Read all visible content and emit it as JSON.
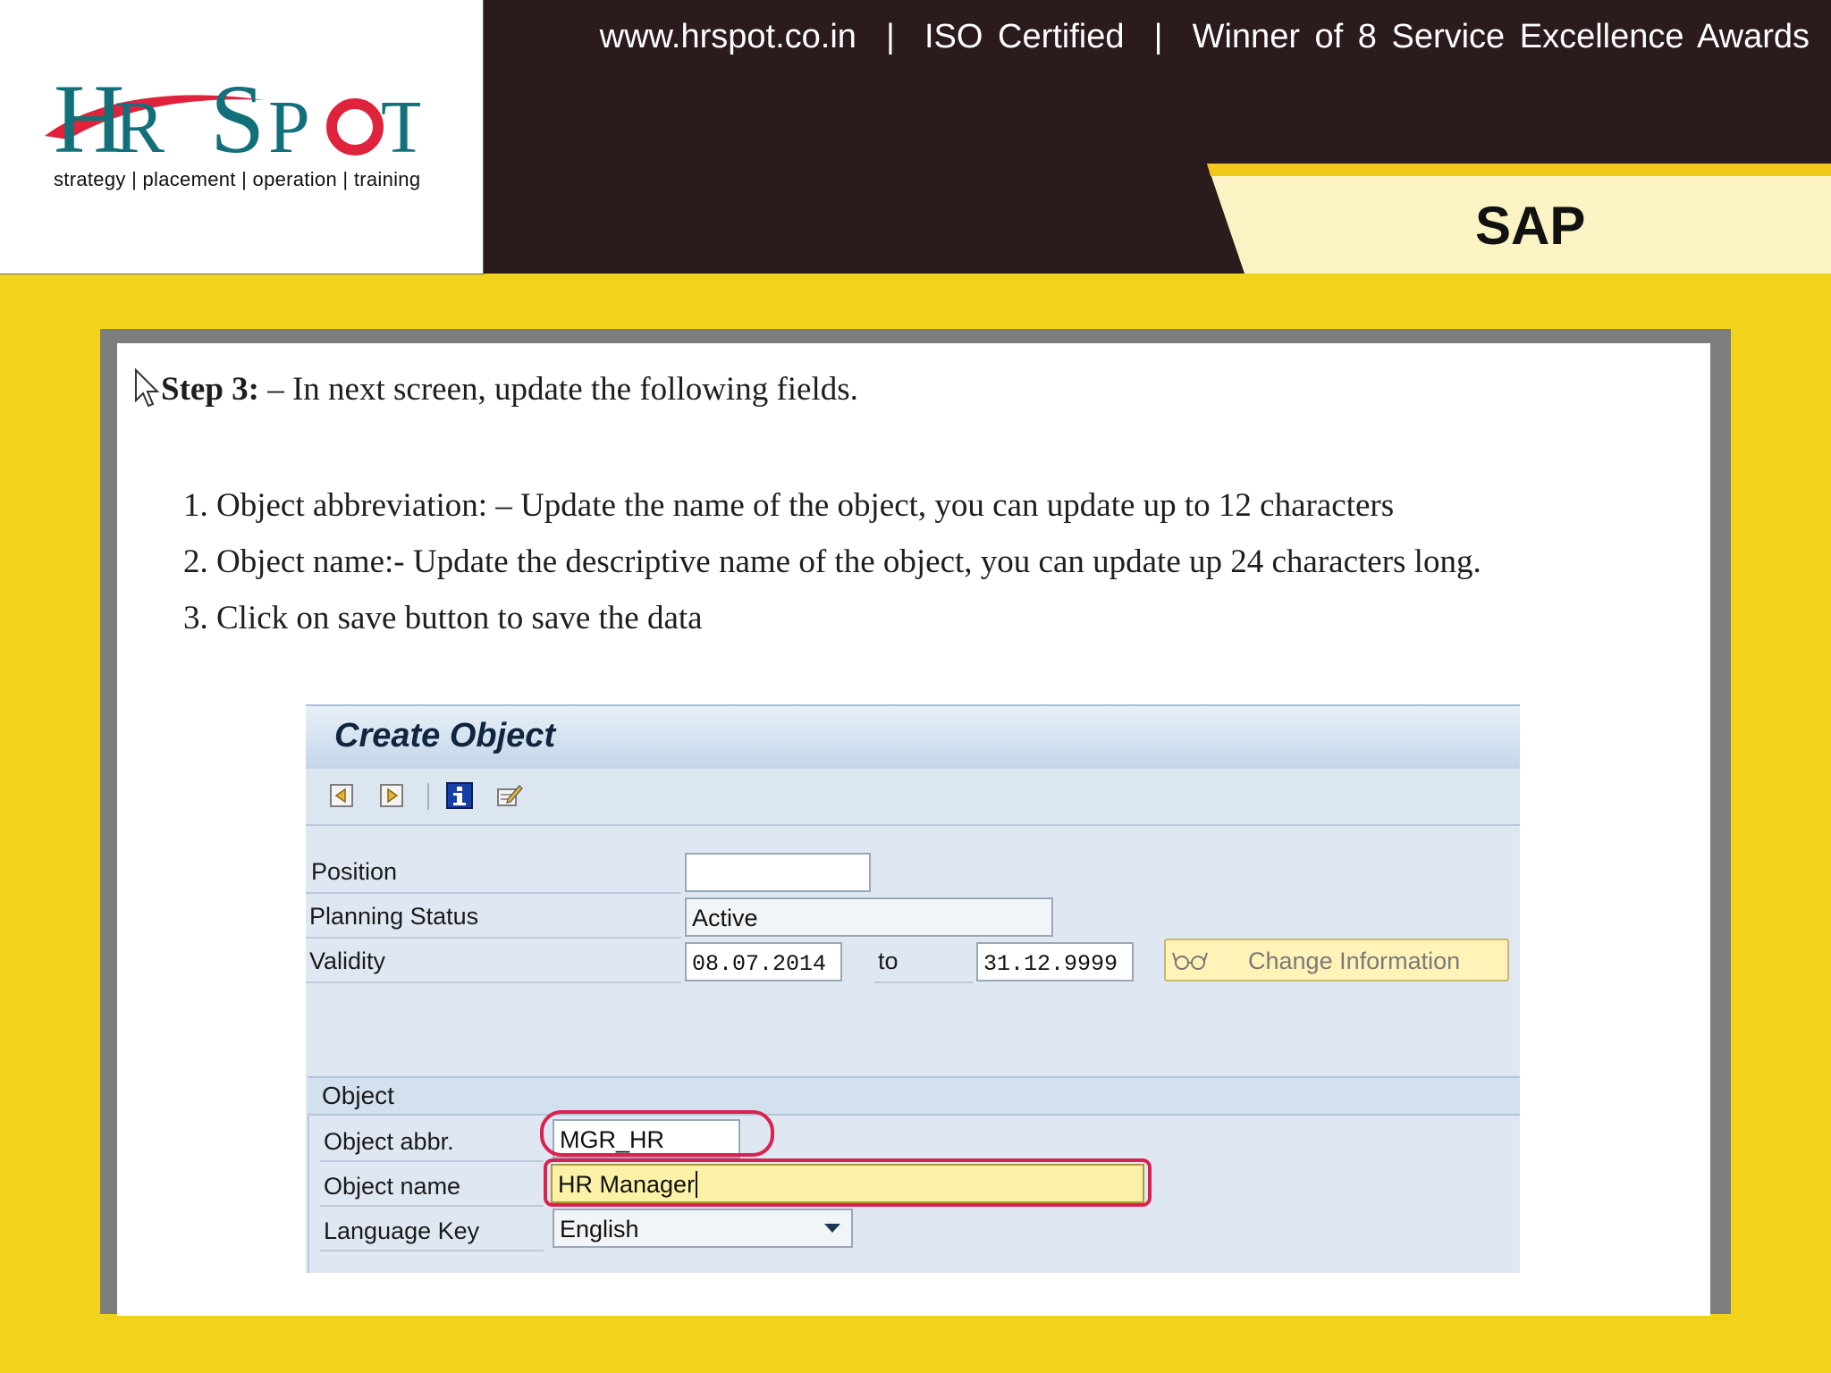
{
  "header": {
    "logo_text": "HR SPOT",
    "logo_tagline": "strategy | placement | operation | training",
    "top_strip": "www.hrspot.co.in  |  ISO Certified  |  Winner of 8 Service Excellence Awards",
    "section_label": "SAP"
  },
  "content": {
    "step_label": "Step 3:",
    "step_text": " – In next screen, update the following fields.",
    "instructions": [
      "1. Object abbreviation: – Update the name of the object, you can update up to 12 characters",
      "2. Object name:- Update the descriptive name of the object, you can update up 24 characters long.",
      "3. Click on save button to save the data"
    ]
  },
  "sap": {
    "title": "Create Object",
    "toolbar": [
      "back-icon",
      "forward-icon",
      "info-icon",
      "edit-icon"
    ],
    "fields": {
      "position_label": "Position",
      "position_value": "",
      "planning_status_label": "Planning Status",
      "planning_status_value": "Active",
      "validity_label": "Validity",
      "validity_from": "08.07.2014",
      "validity_to_label": "to",
      "validity_to": "31.12.9999",
      "change_info_label": "Change Information"
    },
    "object_group": {
      "title": "Object",
      "abbr_label": "Object abbr.",
      "abbr_value": "MGR_HR",
      "name_label": "Object name",
      "name_value": "HR Manager",
      "language_label": "Language Key",
      "language_value": "English"
    },
    "colors": {
      "highlight": "#d9234f",
      "active_field": "#fbf2a8",
      "page_background": "#f0d31a",
      "header_band": "#2b1b1c"
    }
  }
}
